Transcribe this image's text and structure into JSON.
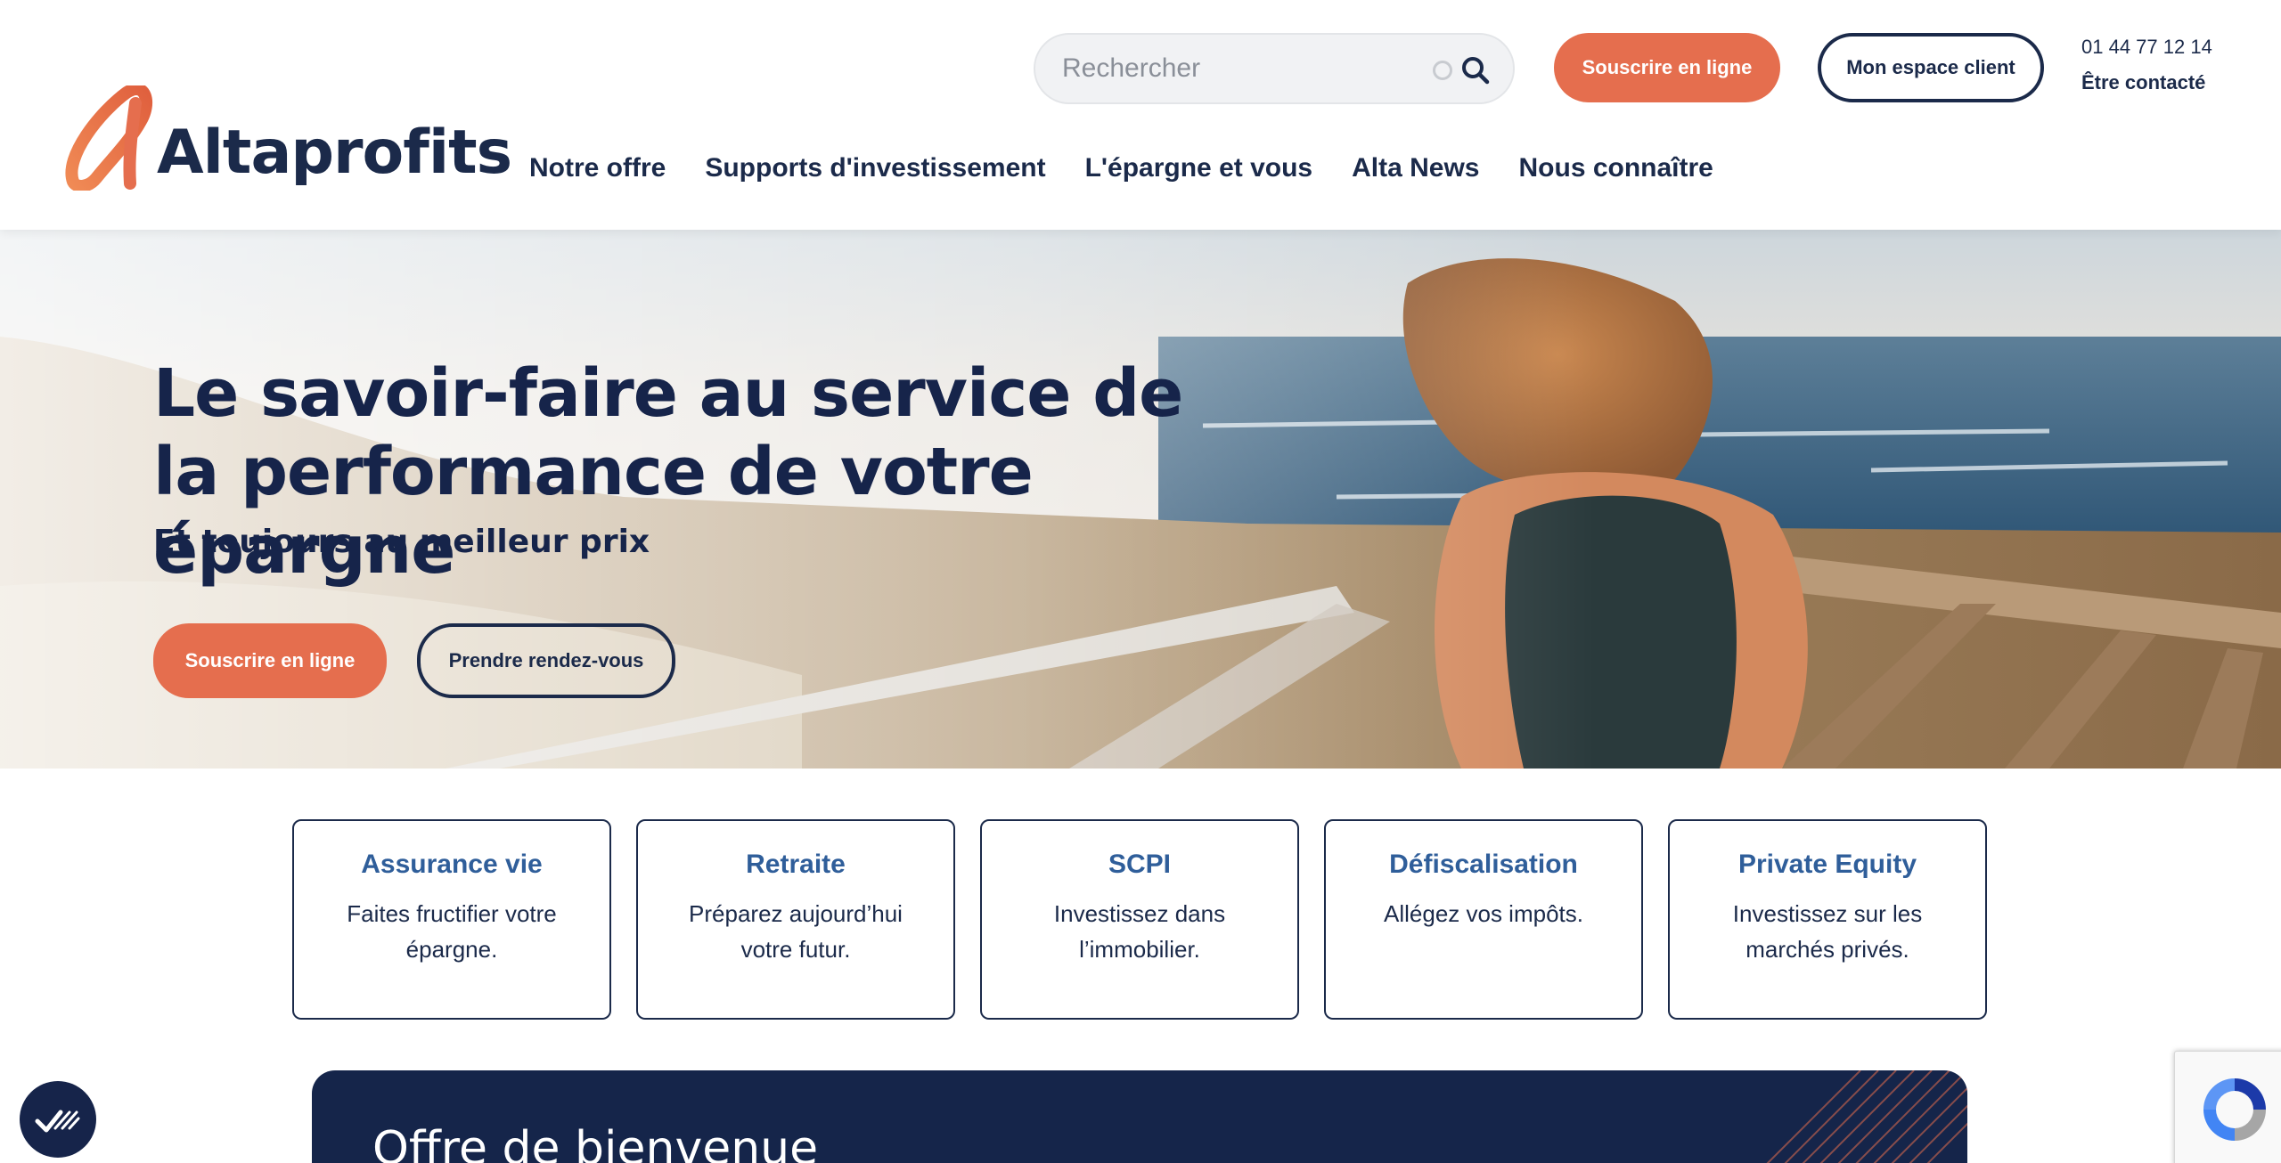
{
  "brand": {
    "name": "Altaprofits",
    "accent": "#e56e4e",
    "navy": "#1b2a4a"
  },
  "header": {
    "search_placeholder": "Rechercher",
    "subscribe_label": "Souscrire en ligne",
    "account_label": "Mon espace client",
    "phone": "01 44 77 12 14",
    "contact_label": "Être contacté"
  },
  "nav": {
    "items": [
      {
        "label": "Notre offre"
      },
      {
        "label": "Supports d'investissement"
      },
      {
        "label": "L'épargne et vous"
      },
      {
        "label": "Alta News"
      },
      {
        "label": "Nous connaître"
      }
    ]
  },
  "hero": {
    "title": "Le savoir-faire au service de la performance de votre épargne",
    "subtitle": "Et toujours au meilleur prix",
    "subscribe_label": "Souscrire en ligne",
    "appointment_label": "Prendre rendez-vous"
  },
  "cards": [
    {
      "title": "Assurance vie",
      "desc": "Faites fructifier votre épargne."
    },
    {
      "title": "Retraite",
      "desc": "Préparez aujourd’hui votre futur."
    },
    {
      "title": "SCPI",
      "desc": "Investissez dans l’immobilier."
    },
    {
      "title": "Défiscalisation",
      "desc": "Allégez vos impôts."
    },
    {
      "title": "Private Equity",
      "desc": "Investissez sur les marchés privés."
    }
  ],
  "welcome": {
    "title": "Offre de bienvenue"
  },
  "icons": {
    "search": "search-icon",
    "consent": "cookie-consent-icon",
    "recaptcha": "recaptcha-icon"
  }
}
